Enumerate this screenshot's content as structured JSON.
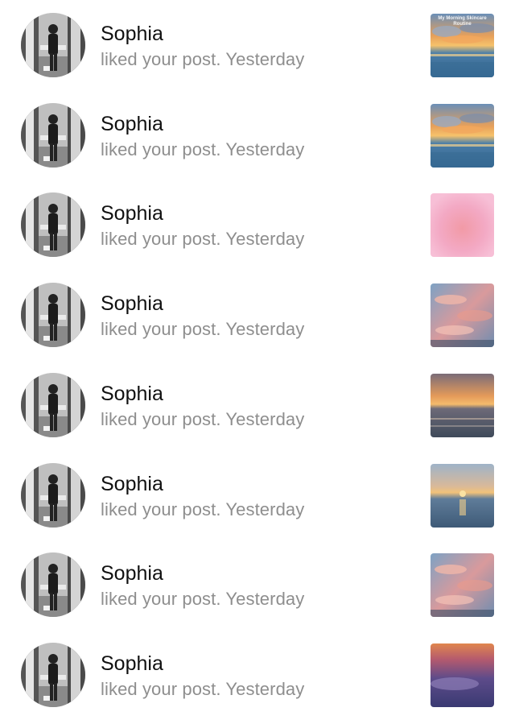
{
  "notifications": [
    {
      "username": "Sophia",
      "action": "liked your post.",
      "time": "Yesterday",
      "thumb": "sunset-clouds",
      "caption": "My Morning Skincare Routine"
    },
    {
      "username": "Sophia",
      "action": "liked your post.",
      "time": "Yesterday",
      "thumb": "sunset-clouds",
      "caption": ""
    },
    {
      "username": "Sophia",
      "action": "liked your post.",
      "time": "Yesterday",
      "thumb": "pink-gradient",
      "caption": ""
    },
    {
      "username": "Sophia",
      "action": "liked your post.",
      "time": "Yesterday",
      "thumb": "pink-sky",
      "caption": ""
    },
    {
      "username": "Sophia",
      "action": "liked your post.",
      "time": "Yesterday",
      "thumb": "sunset-sea",
      "caption": ""
    },
    {
      "username": "Sophia",
      "action": "liked your post.",
      "time": "Yesterday",
      "thumb": "sea-horizon",
      "caption": ""
    },
    {
      "username": "Sophia",
      "action": "liked your post.",
      "time": "Yesterday",
      "thumb": "pink-sky",
      "caption": ""
    },
    {
      "username": "Sophia",
      "action": "liked your post.",
      "time": "Yesterday",
      "thumb": "purple-dusk",
      "caption": ""
    }
  ],
  "colors": {
    "username": "#111111",
    "secondary_text": "#8e8e8e",
    "background": "#ffffff"
  }
}
